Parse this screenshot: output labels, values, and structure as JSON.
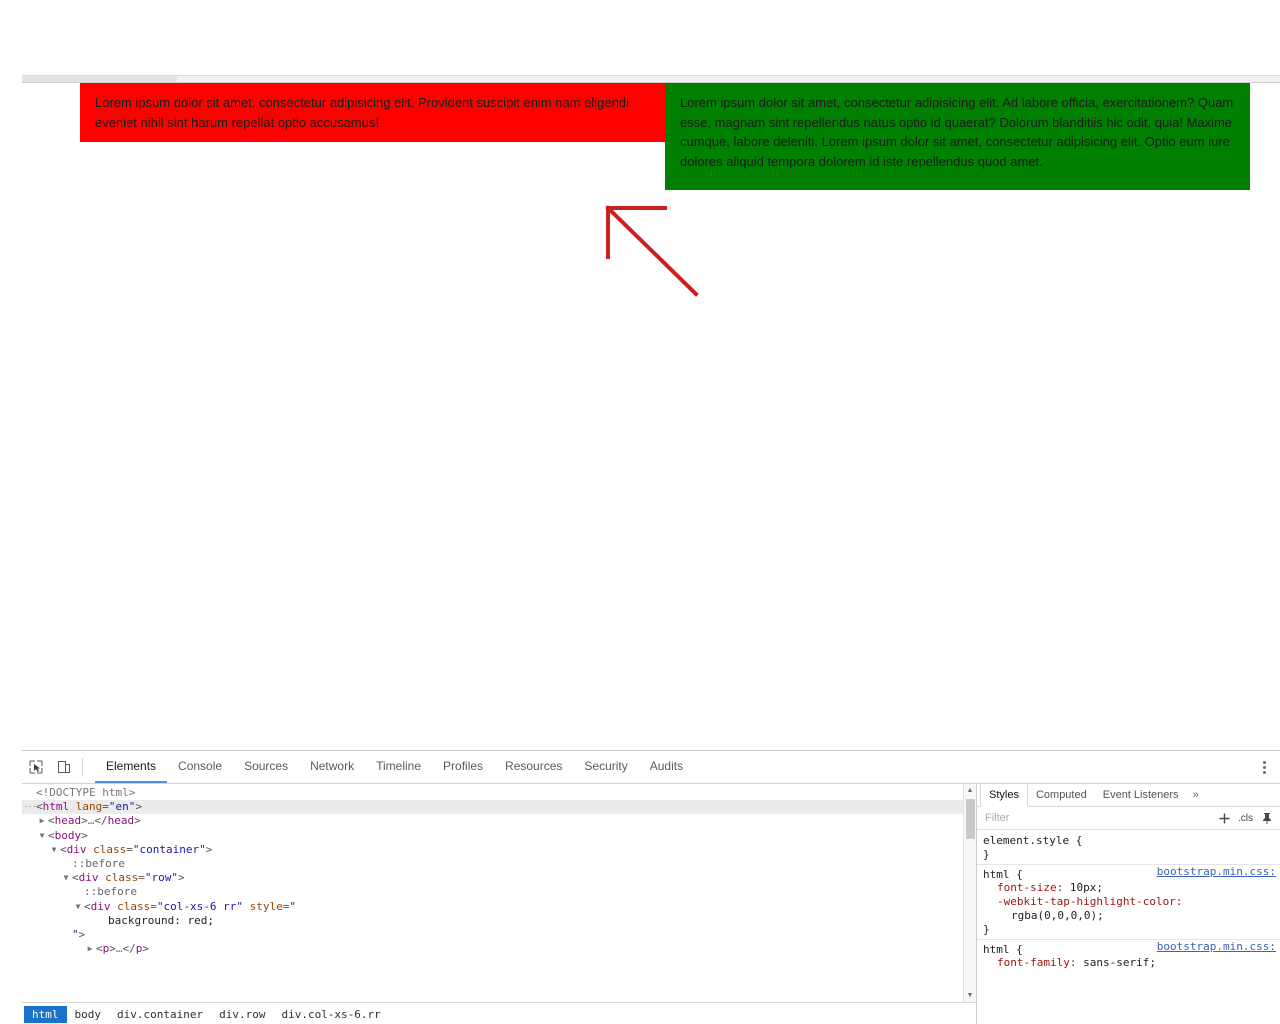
{
  "viewport": {
    "columns": [
      {
        "name": "red-column",
        "color": "#ff0000",
        "text": "Lorem ipsum dolor sit amet, consectetur adipisicing elit. Provident suscipit enim nam eligendi eveniet nihil sint harum repellat optio accusamus!"
      },
      {
        "name": "green-column",
        "color": "#008000",
        "text": "Lorem ipsum dolor sit amet, consectetur adipisicing elit. Ad labore officia, exercitationem? Quam esse, magnam sint repellendus natus optio id quaerat? Dolorum blanditiis hic odit, quia! Maxime cumque, labore deleniti. Lorem ipsum dolor sit amet, consectetur adipisicing elit. Optio eum iure dolores aliquid tempora dolorem id iste repellendus quod amet."
      }
    ],
    "annotation": {
      "type": "arrow",
      "color": "#cc2020"
    }
  },
  "devtools": {
    "toolbar": {
      "inspect_icon": "inspect-element-icon",
      "device_icon": "device-toolbar-icon",
      "menu_icon": "more-options-icon",
      "tabs": [
        {
          "label": "Elements",
          "active": true
        },
        {
          "label": "Console",
          "active": false
        },
        {
          "label": "Sources",
          "active": false
        },
        {
          "label": "Network",
          "active": false
        },
        {
          "label": "Timeline",
          "active": false
        },
        {
          "label": "Profiles",
          "active": false
        },
        {
          "label": "Resources",
          "active": false
        },
        {
          "label": "Security",
          "active": false
        },
        {
          "label": "Audits",
          "active": false
        }
      ]
    },
    "dom": {
      "lines": [
        {
          "indent": 0,
          "twisty": "",
          "html": "<span class=\"dots\">&lt;!DOCTYPE html&gt;</span>",
          "selected": false
        },
        {
          "indent": 0,
          "twisty": "dots",
          "html": "<span class=\"punc\">&lt;</span><span class=\"tag\">html</span> <span class=\"attr\">lang</span><span class=\"punc\">=</span><span class=\"val\">\"en\"</span><span class=\"punc\">&gt;</span>",
          "selected": true
        },
        {
          "indent": 1,
          "twisty": "closed",
          "html": "<span class=\"punc\">&lt;</span><span class=\"tag\">head</span><span class=\"punc\">&gt;</span><span class=\"dots\">…</span><span class=\"punc\">&lt;/</span><span class=\"tag\">head</span><span class=\"punc\">&gt;</span>",
          "selected": false
        },
        {
          "indent": 1,
          "twisty": "open",
          "html": "<span class=\"punc\">&lt;</span><span class=\"tag\">body</span><span class=\"punc\">&gt;</span>",
          "selected": false
        },
        {
          "indent": 2,
          "twisty": "open",
          "html": "<span class=\"punc\">&lt;</span><span class=\"tag\">div</span> <span class=\"attr\">class</span><span class=\"punc\">=</span><span class=\"val\">\"container\"</span><span class=\"punc\">&gt;</span>",
          "selected": false
        },
        {
          "indent": 3,
          "twisty": "",
          "html": "<span class=\"pseudo\">::before</span>",
          "selected": false
        },
        {
          "indent": 3,
          "twisty": "open",
          "html": "<span class=\"punc\">&lt;</span><span class=\"tag\">div</span> <span class=\"attr\">class</span><span class=\"punc\">=</span><span class=\"val\">\"row\"</span><span class=\"punc\">&gt;</span>",
          "selected": false
        },
        {
          "indent": 4,
          "twisty": "",
          "html": "<span class=\"pseudo\">::before</span>",
          "selected": false
        },
        {
          "indent": 4,
          "twisty": "open",
          "html": "<span class=\"punc\">&lt;</span><span class=\"tag\">div</span> <span class=\"attr\">class</span><span class=\"punc\">=</span><span class=\"val\">\"col-xs-6 rr\"</span> <span class=\"attr\">style</span><span class=\"punc\">=</span><span class=\"val\">\"</span>",
          "selected": false
        },
        {
          "indent": 6,
          "twisty": "",
          "html": "<span class=\"cssprop\">background: red;</span>",
          "selected": false
        },
        {
          "indent": 3,
          "twisty": "",
          "html": "<span class=\"val\">\"</span><span class=\"punc\">&gt;</span>",
          "selected": false
        },
        {
          "indent": 5,
          "twisty": "closed",
          "html": "<span class=\"punc\">&lt;</span><span class=\"tag\">p</span><span class=\"punc\">&gt;</span><span class=\"dots\">…</span><span class=\"punc\">&lt;/</span><span class=\"tag\">p</span><span class=\"punc\">&gt;</span>",
          "selected": false
        }
      ],
      "breadcrumb": [
        {
          "label": "html",
          "active": true
        },
        {
          "label": "body",
          "active": false
        },
        {
          "label": "div.container",
          "active": false
        },
        {
          "label": "div.row",
          "active": false
        },
        {
          "label": "div.col-xs-6.rr",
          "active": false
        }
      ]
    },
    "styles": {
      "tabs": [
        {
          "label": "Styles",
          "active": true
        },
        {
          "label": "Computed",
          "active": false
        },
        {
          "label": "Event Listeners",
          "active": false
        }
      ],
      "more_label": "»",
      "filter_placeholder": "Filter",
      "new_rule_icon": "add-style-rule-icon",
      "cls_label": ".cls",
      "pin_icon": "pin-icon",
      "rules": [
        {
          "selector": "element.style {",
          "origin": "",
          "declarations": [],
          "close": "}"
        },
        {
          "selector": "html {",
          "origin": "bootstrap.min.css:",
          "declarations": [
            {
              "name": "font-size",
              "value": "10px;"
            },
            {
              "name": "-webkit-tap-highlight-color",
              "value": ""
            },
            {
              "name": "",
              "value": "rgba(0,0,0,0);"
            }
          ],
          "close": "}"
        },
        {
          "selector": "html {",
          "origin": "bootstrap.min.css:",
          "declarations": [
            {
              "name": "font-family",
              "value": "sans-serif;"
            }
          ],
          "close": ""
        }
      ]
    }
  }
}
